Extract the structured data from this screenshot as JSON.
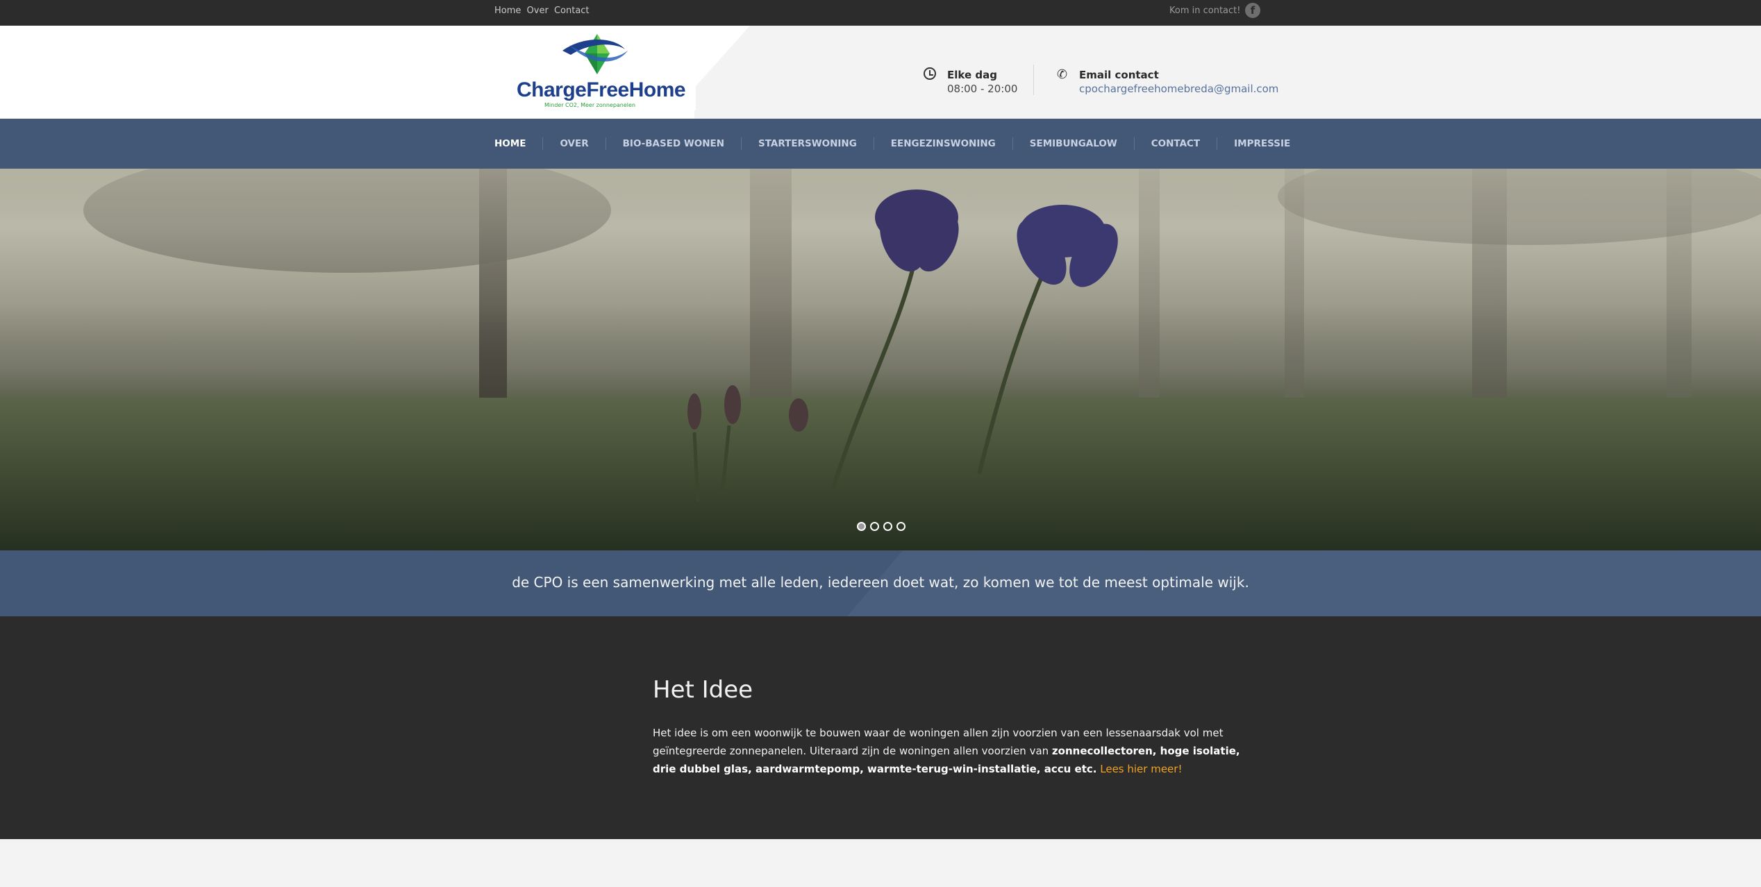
{
  "topbar": {
    "links": [
      "Home",
      "Over",
      "Contact"
    ],
    "contact_text": "Kom in contact!",
    "social_icon": "facebook-icon"
  },
  "logo": {
    "brand": "ChargeFreeHome",
    "tagline": "Minder CO2, Meer zonnepanelen"
  },
  "header": {
    "hours_title": "Elke dag",
    "hours_value": "08:00 - 20:00",
    "email_title": "Email contact",
    "email_value": "cpochargefreehomebreda@gmail.com"
  },
  "nav": {
    "items": [
      "HOME",
      "OVER",
      "BIO-BASED WONEN",
      "STARTERSWONING",
      "EENGEZINSWONING",
      "SEMIBUNGALOW",
      "CONTACT",
      "IMPRESSIE"
    ],
    "active": "HOME"
  },
  "slider": {
    "slide_count": 4,
    "active_index": 0
  },
  "tagline": "de CPO is een samenwerking met alle leden, iedereen doet wat, zo komen we tot de meest optimale wijk.",
  "idea": {
    "title": "Het Idee",
    "intro": "Het idee is om een woonwijk te bouwen waar de woningen allen zijn voorzien van een lessenaarsdak vol met geïntegreerde zonnepanelen. Uiteraard zijn de woningen allen voorzien van ",
    "bold": "zonnecollectoren, hoge isolatie, drie dubbel glas, aardwarmtepomp, warmte-terug-win-installatie, accu etc.",
    "link": "Lees hier meer!"
  },
  "colors": {
    "topbar": "#2c2c2c",
    "nav": "#435876",
    "link_accent": "#f0a322",
    "email_link": "#56739e"
  }
}
